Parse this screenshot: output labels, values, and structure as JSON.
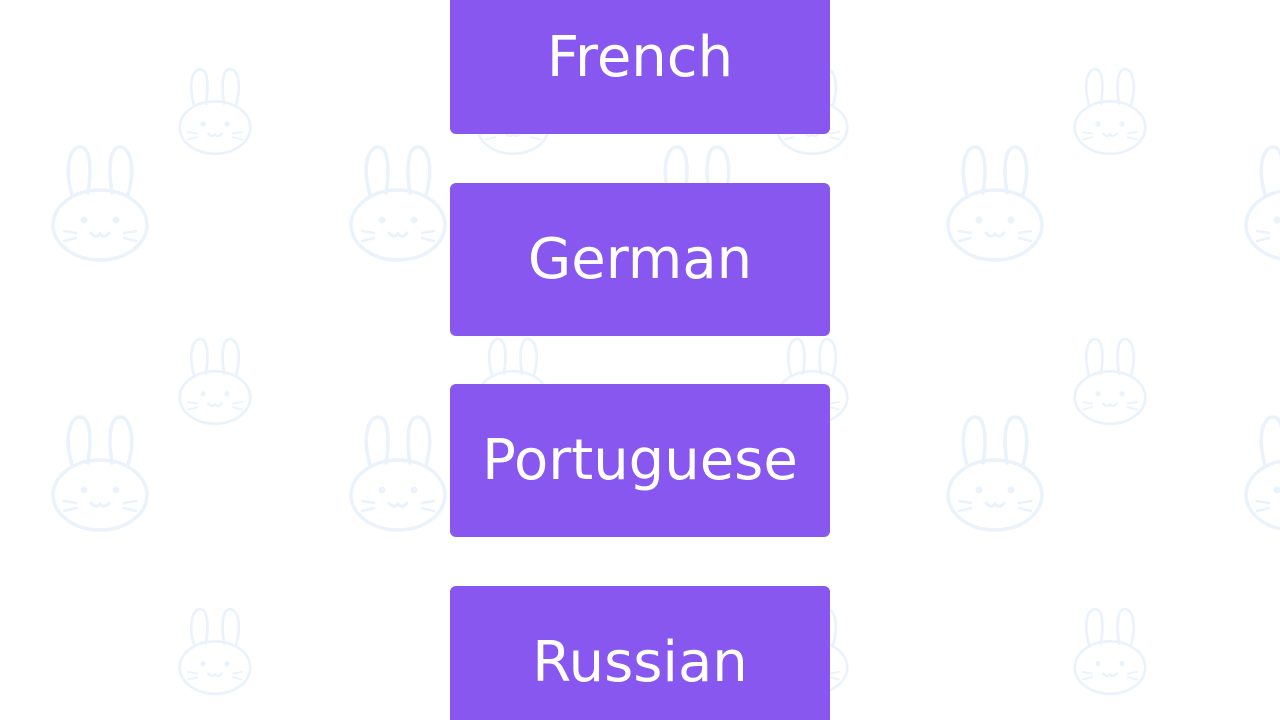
{
  "theme": {
    "button_color": "#8757f0",
    "button_text_color": "#ffffff",
    "pattern_color": "#eaf2fb"
  },
  "background": {
    "pattern_icon": "bunny-face-icon"
  },
  "language_options": [
    {
      "label": "French"
    },
    {
      "label": "German"
    },
    {
      "label": "Portuguese"
    },
    {
      "label": "Russian"
    }
  ]
}
